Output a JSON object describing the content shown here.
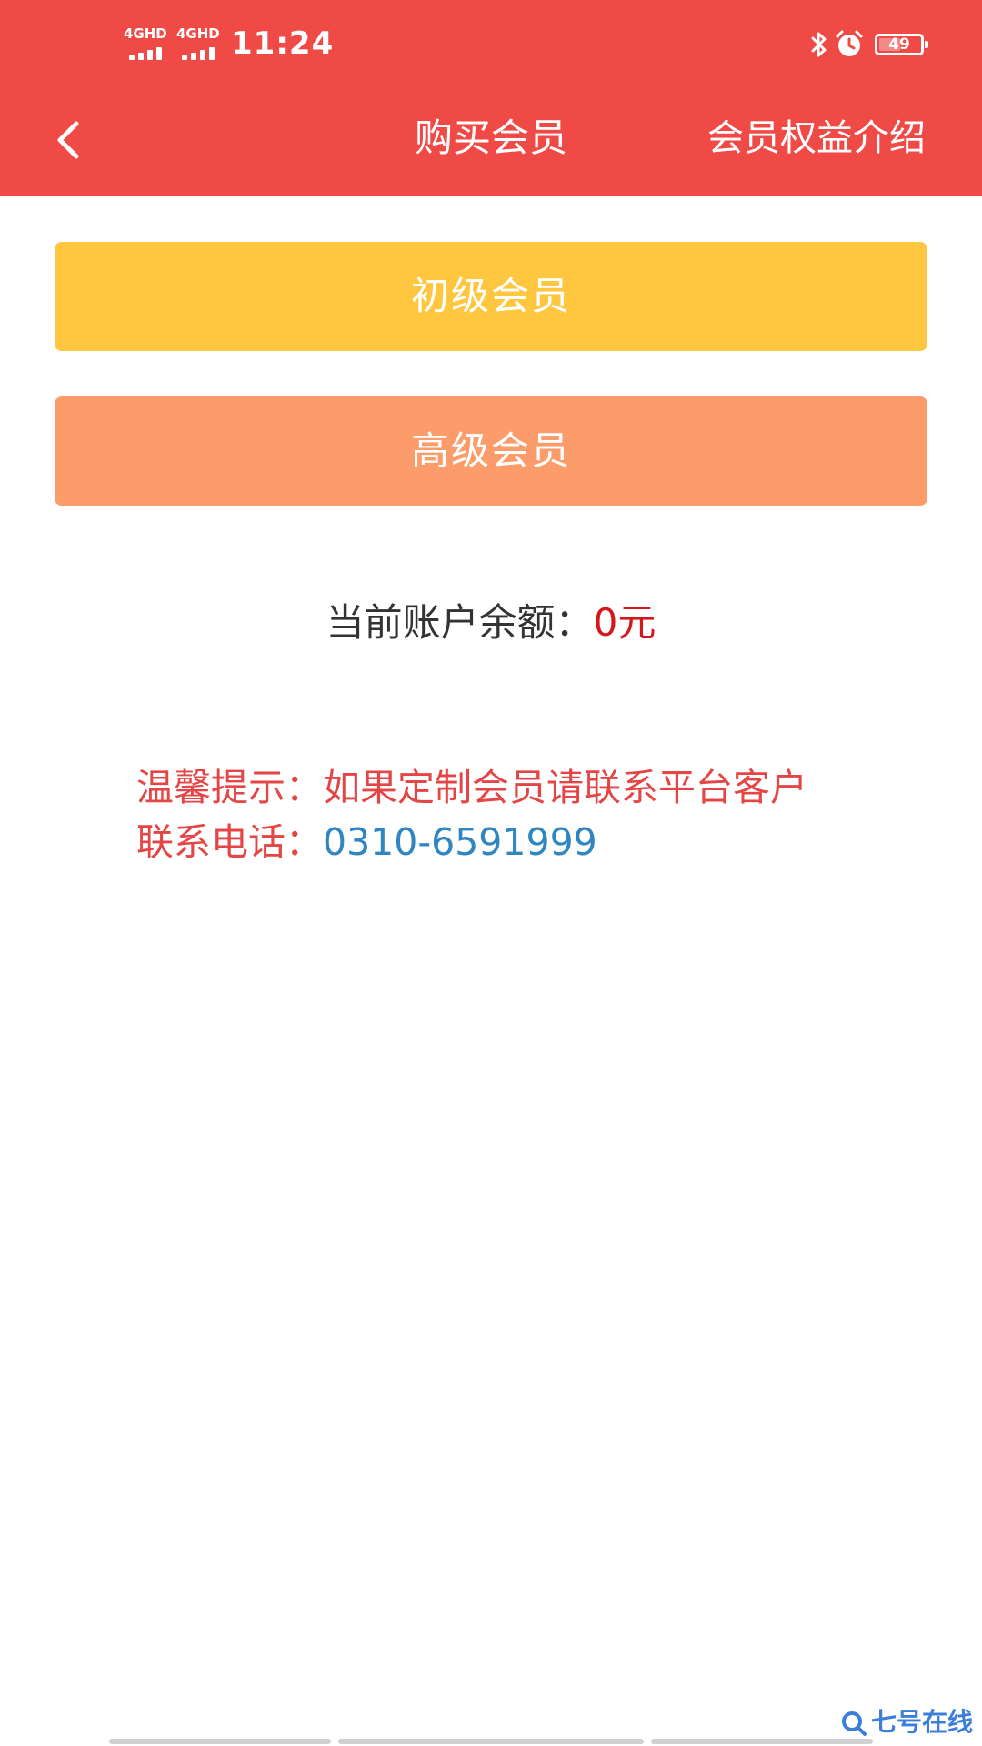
{
  "status_bar": {
    "network_1": "4GHD",
    "network_2": "4GHD",
    "time": "11:24",
    "battery": "49",
    "icons": [
      "bluetooth-icon",
      "alarm-icon",
      "battery-icon"
    ]
  },
  "nav": {
    "back_icon": "chevron-left-icon",
    "title": "购买会员",
    "benefits_link": "会员权益介绍"
  },
  "membership": {
    "tiers": [
      {
        "label": "初级会员",
        "color": "#ffc63f"
      },
      {
        "label": "高级会员",
        "color": "#fc9c6a"
      }
    ]
  },
  "balance": {
    "label": "当前账户余额：",
    "amount": "0元"
  },
  "notice": {
    "tip_label": "温馨提示：",
    "tip_text": "如果定制会员请联系平台客户",
    "phone_label": "联系电话：",
    "phone_number": "0310-6591999"
  },
  "watermark": {
    "icon": "search-logo-icon",
    "text": "七号在线"
  },
  "colors": {
    "header": "#f04a47",
    "balance_amount": "#d4171b",
    "notice_text": "#e54545",
    "phone_link": "#2f86c0"
  }
}
